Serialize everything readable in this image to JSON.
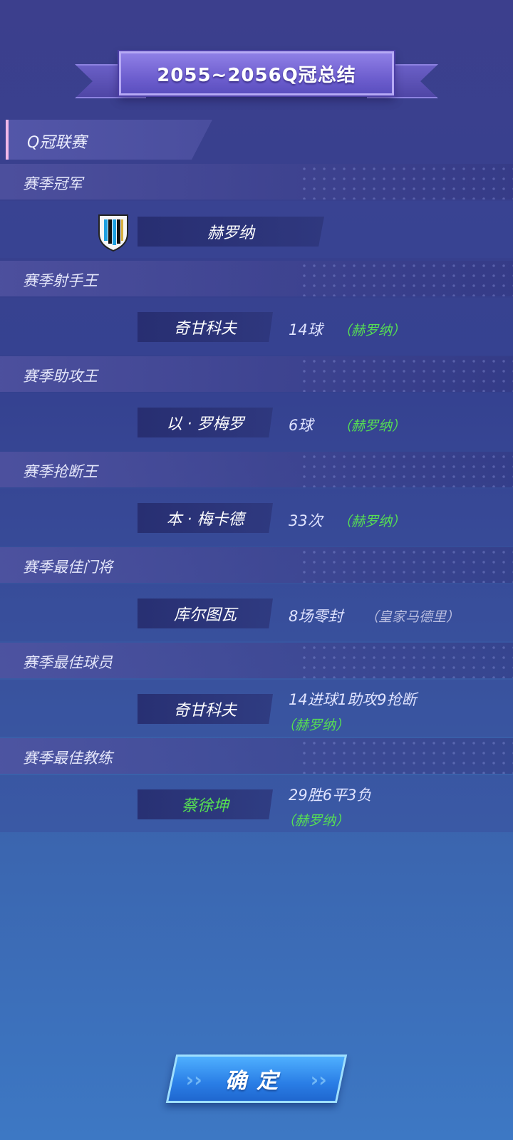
{
  "title": "2055~2056Q冠总结",
  "league_label": "Q冠联赛",
  "sections": {
    "champion": {
      "header": "赛季冠军",
      "team": "赫罗纳"
    },
    "top_scorer": {
      "header": "赛季射手王",
      "name": "奇甘科夫",
      "stat": "14球",
      "club": "（赫罗纳）"
    },
    "top_assist": {
      "header": "赛季助攻王",
      "name": "以 · 罗梅罗",
      "stat": "6球",
      "club": "（赫罗纳）"
    },
    "top_tackle": {
      "header": "赛季抢断王",
      "name": "本 · 梅卡德",
      "stat": "33次",
      "club": "（赫罗纳）"
    },
    "best_keeper": {
      "header": "赛季最佳门将",
      "name": "库尔图瓦",
      "stat": "8场零封",
      "club": "（皇家马德里）"
    },
    "best_player": {
      "header": "赛季最佳球员",
      "name": "奇甘科夫",
      "stat": "14进球1助攻9抢断",
      "club": "（赫罗纳）"
    },
    "best_coach": {
      "header": "赛季最佳教练",
      "name": "蔡徐坤",
      "stat": "29胜6平3负",
      "club": "（赫罗纳）"
    }
  },
  "confirm_label": "确定",
  "colors": {
    "club_green": "#56e052",
    "accent_purple": "#6e5fcf",
    "button_blue": "#2a7ee6"
  },
  "icons": {
    "team_crest": "shield-crest-icon",
    "button_decoration": "chevron-right-icon"
  }
}
